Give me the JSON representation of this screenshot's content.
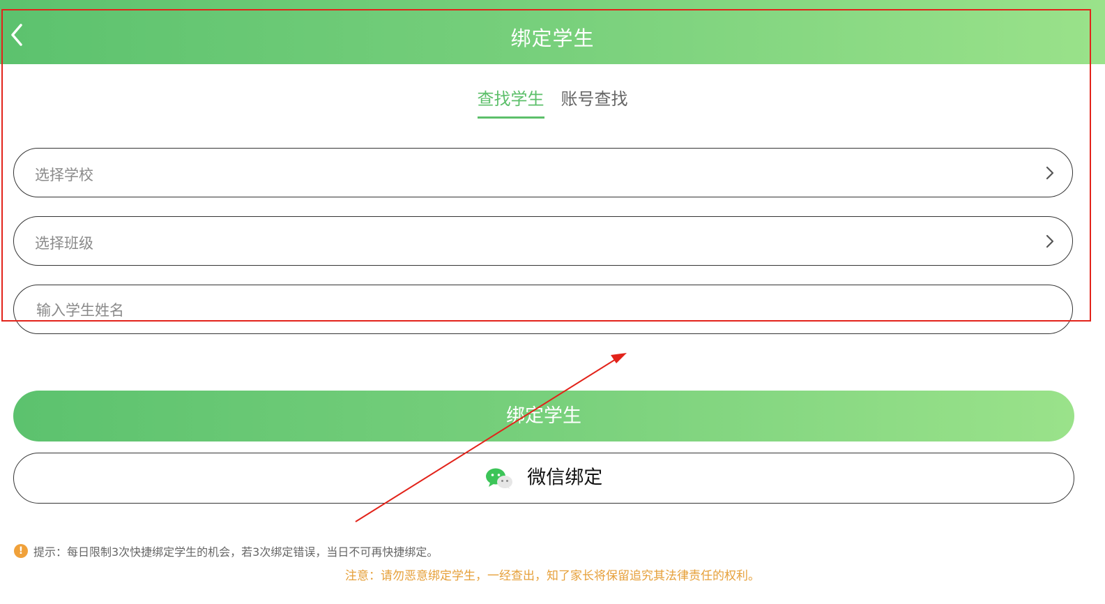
{
  "header": {
    "title": "绑定学生",
    "back_icon": "chevron-left-icon"
  },
  "tabs": [
    {
      "label": "查找学生",
      "active": true
    },
    {
      "label": "账号查找",
      "active": false
    }
  ],
  "form": {
    "school_placeholder": "选择学校",
    "class_placeholder": "选择班级",
    "name_placeholder": "输入学生姓名"
  },
  "buttons": {
    "bind_label": "绑定学生",
    "wechat_label": "微信绑定"
  },
  "tip": {
    "text": "提示：每日限制3次快捷绑定学生的机会，若3次绑定错误，当日不可再快捷绑定。"
  },
  "notice": {
    "text": "注意：请勿恶意绑定学生，一经查出，知了家长将保留追究其法律责任的权利。"
  },
  "colors": {
    "brand_green": "#5cbf6a",
    "gradient_start": "#5cc26e",
    "gradient_end": "#9ae28a",
    "notice_orange": "#e6a03a",
    "annotation_red": "#e2231a"
  }
}
